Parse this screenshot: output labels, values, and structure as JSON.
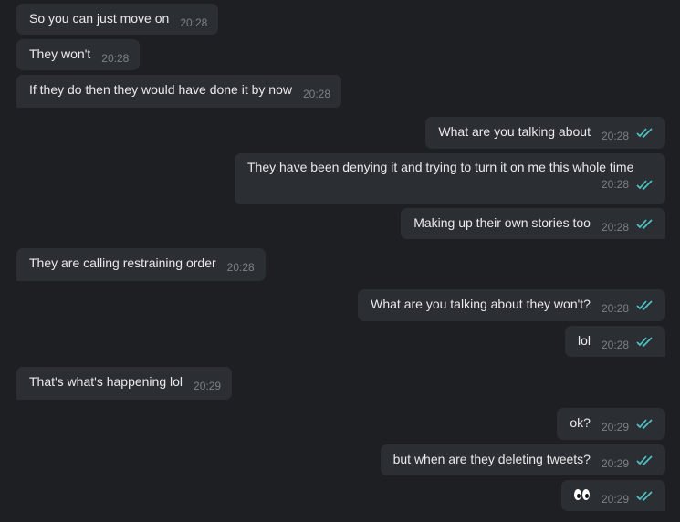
{
  "conversation": {
    "messages": [
      {
        "direction": "incoming",
        "text": "So you can just move on",
        "time": "20:28"
      },
      {
        "direction": "incoming",
        "text": "They won't",
        "time": "20:28"
      },
      {
        "direction": "incoming",
        "text": "If they do then they would have done it by now",
        "time": "20:28"
      },
      {
        "direction": "outgoing",
        "text": "What are you talking about",
        "time": "20:28",
        "status": "read"
      },
      {
        "direction": "outgoing",
        "text": "They have been denying it and trying to turn it on me this whole time",
        "time": "20:28",
        "status": "read"
      },
      {
        "direction": "outgoing",
        "text": "Making up their own stories too",
        "time": "20:28",
        "status": "read"
      },
      {
        "direction": "incoming",
        "text": "They are calling restraining order",
        "time": "20:28"
      },
      {
        "direction": "outgoing",
        "text": "What are you talking about they won't?",
        "time": "20:28",
        "status": "read"
      },
      {
        "direction": "outgoing",
        "text": "lol",
        "time": "20:28",
        "status": "read"
      },
      {
        "direction": "incoming",
        "text": "That's what's happening lol",
        "time": "20:29"
      },
      {
        "direction": "outgoing",
        "text": "ok?",
        "time": "20:29",
        "status": "read"
      },
      {
        "direction": "outgoing",
        "text": "but when are they deleting tweets?",
        "time": "20:29",
        "status": "read"
      },
      {
        "direction": "outgoing",
        "emoji": "eyes",
        "time": "20:29",
        "status": "read"
      }
    ]
  },
  "colors": {
    "background": "#1e1f23",
    "bubble": "#2b2e33",
    "text": "#e9eaec",
    "timestamp": "#7d8187",
    "read_check": "#4fc3c4"
  },
  "icons": {
    "read_receipt": "double-check-icon",
    "emoji": "eyes-emoji-icon"
  }
}
